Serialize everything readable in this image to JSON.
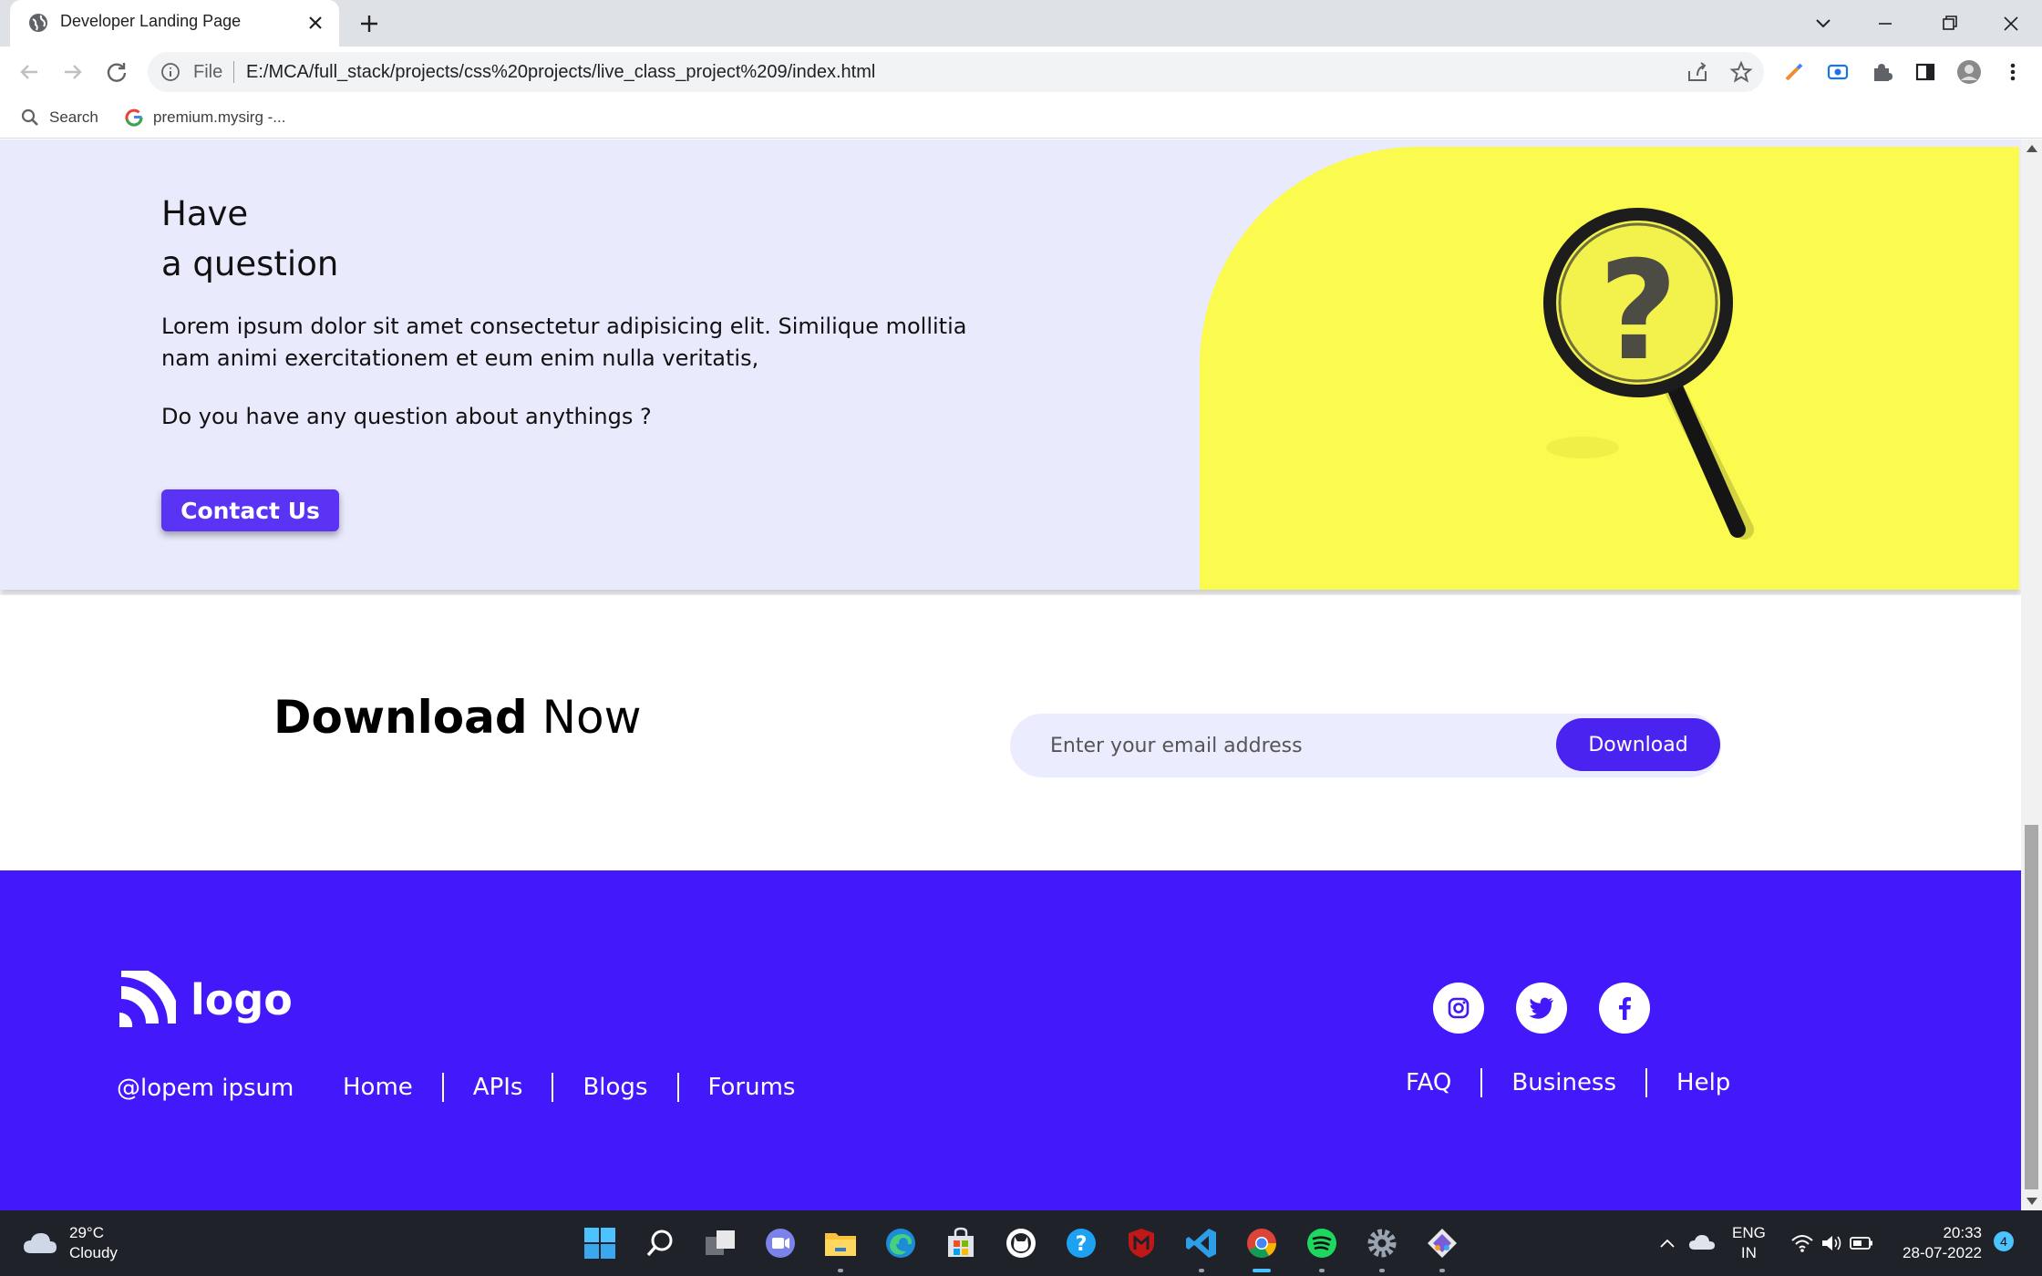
{
  "browser": {
    "tab_title": "Developer Landing Page",
    "omnibox_scheme": "File",
    "url": "E:/MCA/full_stack/projects/css%20projects/live_class_project%209/index.html",
    "bookmarks": [
      "Search",
      "premium.mysirg -..."
    ]
  },
  "question": {
    "title_line1": "Have",
    "title_line2": "a question",
    "body": "Lorem ipsum dolor sit amet consectetur adipisicing elit. Similique mollitia nam animi exercitationem et eum enim nulla veritatis,",
    "prompt": "Do you have any question about anythings ?",
    "contact_label": "Contact Us",
    "image_bg": "#fbfa4e"
  },
  "download": {
    "heading_bold": "Download",
    "heading_rest": "Now",
    "email_placeholder": "Enter your email address",
    "button_label": "Download"
  },
  "footer": {
    "logo_text": "logo",
    "copyright": "@lopem ipsum",
    "nav": [
      "Home",
      "APIs",
      "Blogs",
      "Forums"
    ],
    "links": [
      "FAQ",
      "Business",
      "Help"
    ],
    "social": [
      "instagram-icon",
      "twitter-icon",
      "facebook-icon"
    ],
    "bg": "#4318fa"
  },
  "taskbar": {
    "temperature": "29°C",
    "weather": "Cloudy",
    "lang1": "ENG",
    "lang2": "IN",
    "time": "20:33",
    "date": "28-07-2022",
    "notifications": "4"
  }
}
